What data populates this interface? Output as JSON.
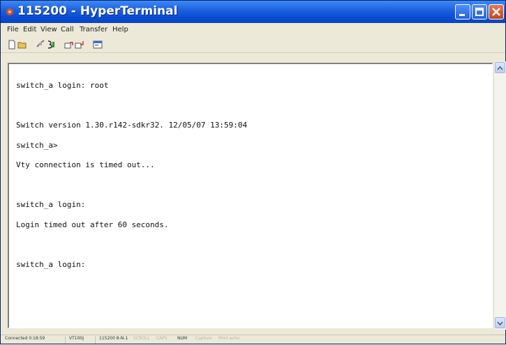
{
  "window": {
    "title": "115200 - HyperTerminal"
  },
  "menu": [
    "File",
    "Edit",
    "View",
    "Call",
    "Transfer",
    "Help"
  ],
  "toolbar": {
    "icons": [
      "new-connection-icon",
      "open-icon",
      "connect-icon",
      "disconnect-icon",
      "send-file-icon",
      "receive-file-icon",
      "properties-icon"
    ]
  },
  "terminal": {
    "lines": [
      "switch_a login: root",
      "",
      "Switch version 1.30.r142-sdkr32. 12/05/07 13:59:04",
      "switch_a>",
      "Vty connection is timed out...",
      "",
      "switch_a login:",
      "Login timed out after 60 seconds.",
      "",
      "switch_a login:"
    ]
  },
  "status": {
    "connected": "Connected 0:18:59",
    "emulation": "VT100J",
    "settings": "115200 8-N-1",
    "scroll": "SCROLL",
    "caps": "CAPS",
    "num": "NUM",
    "capture": "Capture",
    "print_echo": "Print echo"
  },
  "colors": {
    "titlebar": "#0a4fd6",
    "window_bg": "#ece9d8",
    "terminal_bg": "#ffffff",
    "close_button": "#c3441c"
  }
}
